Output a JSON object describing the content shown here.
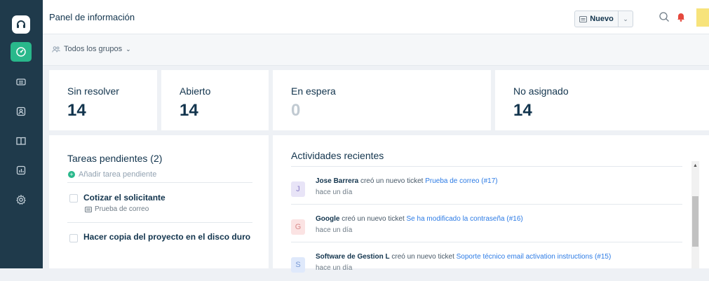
{
  "header": {
    "title": "Panel de información",
    "new_label": "Nuevo"
  },
  "filter": {
    "groups_label": "Todos los grupos"
  },
  "stats": [
    {
      "label": "Sin resolver",
      "value": "14"
    },
    {
      "label": "Abierto",
      "value": "14"
    },
    {
      "label": "En espera",
      "value": "0"
    },
    {
      "label": "No asignado",
      "value": "14"
    }
  ],
  "tasks": {
    "title": "Tareas pendientes (2)",
    "add_label": "Añadir tarea pendiente",
    "items": [
      {
        "label": "Cotizar el solicitante",
        "ticket": "Prueba de correo"
      },
      {
        "label": "Hacer copia del proyecto en el disco duro"
      }
    ]
  },
  "activities": {
    "title": "Actividades recientes",
    "items": [
      {
        "avatar": "J",
        "actor": "Jose Barrera",
        "action": "creó un nuevo ticket",
        "ticket": "Prueba de correo (#17)",
        "time": "hace un día",
        "avatar_bg": "#e8e4f7",
        "avatar_fg": "#8b7fc7"
      },
      {
        "avatar": "G",
        "actor": "Google",
        "action": "creó un nuevo ticket",
        "ticket": "Se ha modificado la contraseña (#16)",
        "time": "hace un día",
        "avatar_bg": "#fbe3e3",
        "avatar_fg": "#d98a8a"
      },
      {
        "avatar": "S",
        "actor": "Software de Gestion L",
        "action": "creó un nuevo ticket",
        "ticket": "Soporte técnico email activation instructions (#15)",
        "time": "hace un día",
        "avatar_bg": "#dfe9fb",
        "avatar_fg": "#7a9bd6"
      }
    ]
  },
  "colors": {
    "sidebar": "#1f3a4b",
    "accent": "#29b88b",
    "link": "#2c7be5"
  },
  "icons": [
    "headset-logo-icon",
    "dashboard-icon",
    "ticket-icon",
    "contacts-icon",
    "book-icon",
    "reports-icon",
    "settings-icon",
    "search-icon",
    "notification-icon",
    "groups-icon"
  ]
}
